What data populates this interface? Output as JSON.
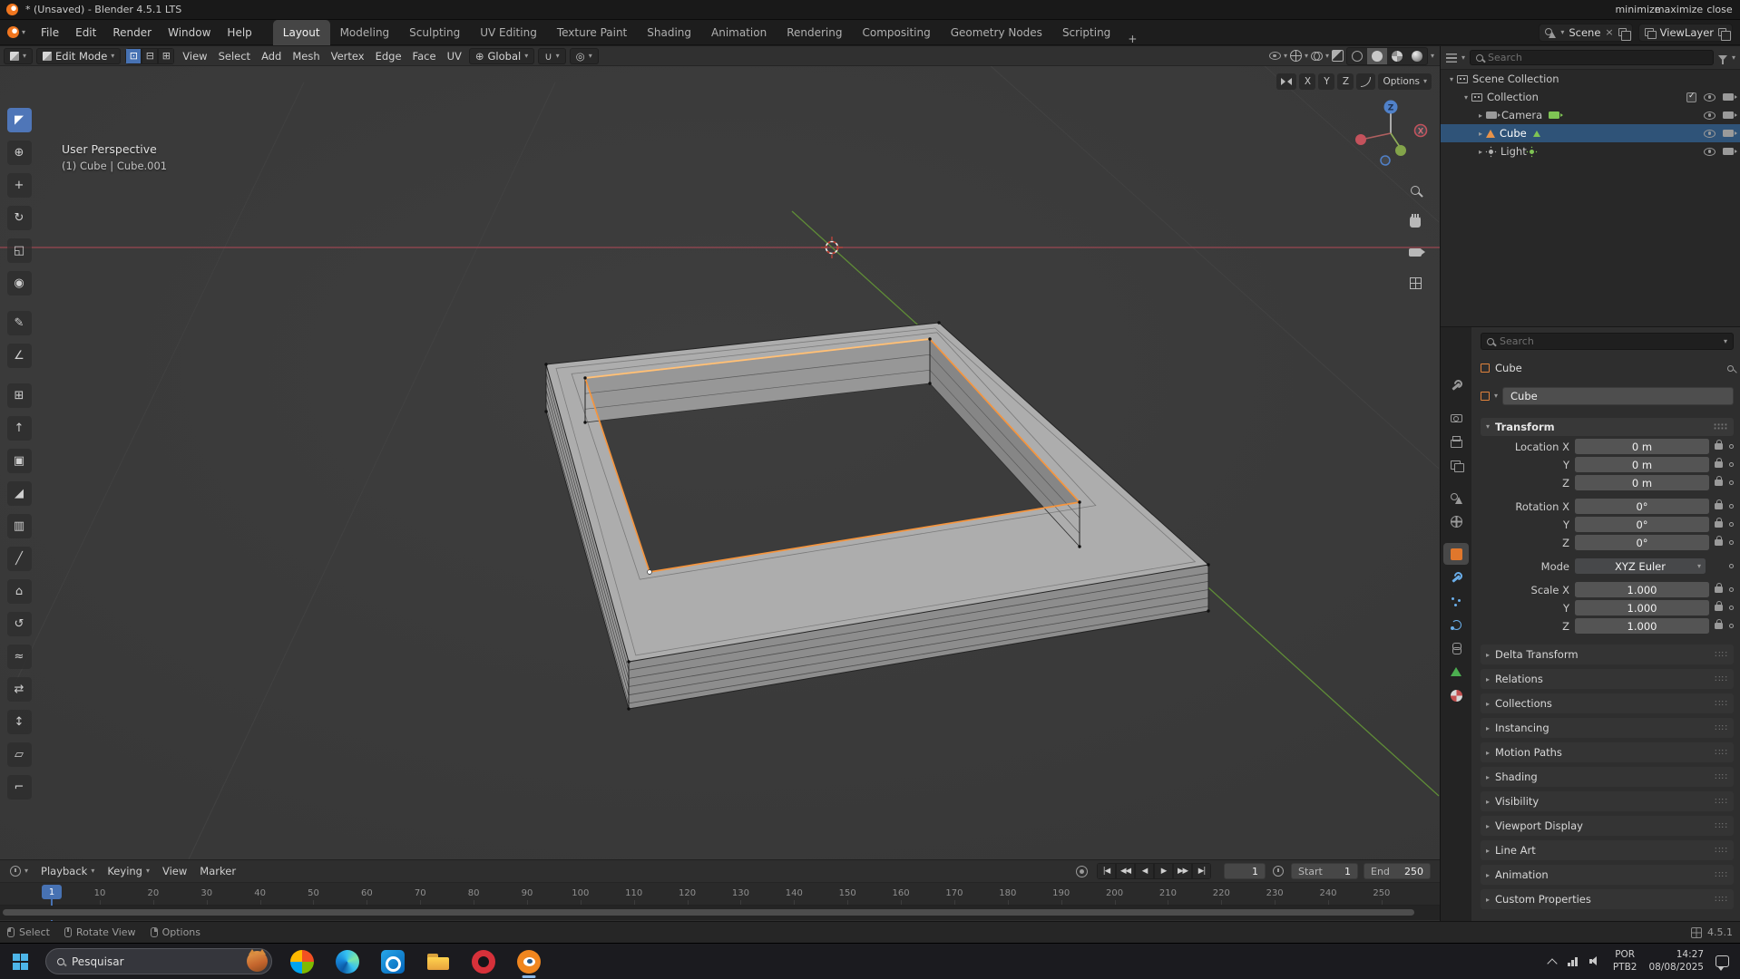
{
  "colors": {
    "accent_blue": "#4772b3",
    "selection_orange": "#f5953e",
    "object_orange": "#e0772c"
  },
  "window": {
    "title": "* (Unsaved) - Blender 4.5.1 LTS",
    "controls": [
      "minimize",
      "maximize",
      "close"
    ]
  },
  "menubar": {
    "menus": [
      "File",
      "Edit",
      "Render",
      "Window",
      "Help"
    ],
    "workspaces": [
      "Layout",
      "Modeling",
      "Sculpting",
      "UV Editing",
      "Texture Paint",
      "Shading",
      "Animation",
      "Rendering",
      "Compositing",
      "Geometry Nodes",
      "Scripting"
    ],
    "active_workspace": "Layout",
    "add_workspace_label": "+",
    "scene": {
      "label": "Scene"
    },
    "viewlayer": {
      "label": "ViewLayer"
    }
  },
  "viewport": {
    "header": {
      "mode": "Edit Mode",
      "select_modes": [
        "vertex-select",
        "edge-select",
        "face-select"
      ],
      "active_select_mode": "vertex-select",
      "menus": [
        "View",
        "Select",
        "Add",
        "Mesh",
        "Vertex",
        "Edge",
        "Face",
        "UV"
      ],
      "orientation": "Global",
      "shading_modes": [
        "wireframe",
        "solid",
        "material-preview",
        "rendered"
      ],
      "active_shading": "solid"
    },
    "tool_settings": {
      "mirror_x": "X",
      "mirror_y": "Y",
      "mirror_z": "Z",
      "options_label": "Options"
    },
    "overlay": {
      "view_name": "User Perspective",
      "object_info": "(1) Cube | Cube.001"
    },
    "nav_gizmo": {
      "x_label": "X",
      "z_label": "Z"
    },
    "side_icons": [
      "zoom-icon",
      "move-view-icon",
      "camera-view-icon",
      "toggle-projection-icon"
    ]
  },
  "toolbar": {
    "active_tool": "tweak",
    "tools": [
      "tweak",
      "cursor",
      "move",
      "rotate",
      "scale",
      "transform",
      "annotate",
      "measure",
      "add-cube",
      "extrude-region",
      "inset-faces",
      "bevel",
      "loop-cut",
      "knife",
      "poly-build",
      "spin",
      "smooth",
      "edge-slide",
      "shrink-fatten",
      "shear",
      "rip-region"
    ]
  },
  "outliner": {
    "search_placeholder": "Search",
    "rows": [
      {
        "label": "Scene Collection",
        "icon": "scene-collection",
        "arrow": "down",
        "indent": 0
      },
      {
        "label": "Collection",
        "icon": "collection",
        "arrow": "down",
        "indent": 1,
        "checkbox": true,
        "eye": true,
        "camera": true
      },
      {
        "label": "Camera",
        "icon": "camera",
        "data_icon": "camera-data",
        "arrow": "right",
        "indent": 2,
        "eye": true,
        "camera": true
      },
      {
        "label": "Cube",
        "icon": "mesh",
        "data_icon": "mesh-data",
        "arrow": "right",
        "indent": 2,
        "selected": true,
        "eye": true,
        "camera": true
      },
      {
        "label": "Light",
        "icon": "light",
        "data_icon": "light-data",
        "arrow": "right",
        "indent": 2,
        "eye": true,
        "camera": true
      }
    ]
  },
  "properties": {
    "search_placeholder": "Search",
    "breadcrumb": "Cube",
    "object_name": "Cube",
    "tabs": [
      "tool",
      "render",
      "output",
      "view-layer",
      "scene",
      "world",
      "object",
      "modifiers",
      "particles",
      "physics",
      "constraints",
      "object-data",
      "material"
    ],
    "active_tab": "object",
    "transform": {
      "title": "Transform",
      "rows": [
        {
          "label": "Location X",
          "value": "0 m",
          "type": "number",
          "group_start": false
        },
        {
          "label": "Y",
          "value": "0 m",
          "type": "number"
        },
        {
          "label": "Z",
          "value": "0 m",
          "type": "number"
        },
        {
          "label": "Rotation X",
          "value": "0°",
          "type": "number",
          "group_start": true
        },
        {
          "label": "Y",
          "value": "0°",
          "type": "number"
        },
        {
          "label": "Z",
          "value": "0°",
          "type": "number"
        },
        {
          "label": "Mode",
          "value": "XYZ Euler",
          "type": "dropdown",
          "group_start": true
        },
        {
          "label": "Scale X",
          "value": "1.000",
          "type": "number",
          "group_start": true
        },
        {
          "label": "Y",
          "value": "1.000",
          "type": "number"
        },
        {
          "label": "Z",
          "value": "1.000",
          "type": "number"
        }
      ]
    },
    "sections": [
      "Delta Transform",
      "Relations",
      "Collections",
      "Instancing",
      "Motion Paths",
      "Shading",
      "Visibility",
      "Viewport Display",
      "Line Art",
      "Animation",
      "Custom Properties"
    ]
  },
  "timeline": {
    "menus": [
      {
        "label": "Playback",
        "caret": true
      },
      {
        "label": "Keying",
        "caret": true
      },
      {
        "label": "View",
        "caret": false
      },
      {
        "label": "Marker",
        "caret": false
      }
    ],
    "transport": [
      "jump-to-start",
      "previous-keyframe",
      "play-reverse",
      "play",
      "next-keyframe",
      "jump-to-end"
    ],
    "current_frame": "1",
    "start_label": "Start",
    "start_value": "1",
    "end_label": "End",
    "end_value": "250",
    "ticks": [
      "10",
      "20",
      "30",
      "40",
      "50",
      "60",
      "70",
      "80",
      "90",
      "100",
      "110",
      "120",
      "130",
      "140",
      "150",
      "160",
      "170",
      "180",
      "190",
      "200",
      "210",
      "220",
      "230",
      "240",
      "250"
    ]
  },
  "statusbar": {
    "hints": [
      {
        "button": "left",
        "label": "Select"
      },
      {
        "button": "middle",
        "label": "Rotate View"
      },
      {
        "button": "right",
        "label": "Options"
      }
    ],
    "version": "4.5.1"
  },
  "taskbar": {
    "search_placeholder": "Pesquisar",
    "apps": [
      "copilot",
      "edge",
      "outlook",
      "explorer",
      "opera",
      "blender"
    ],
    "active_app": "blender",
    "tray": {
      "language_top": "POR",
      "language_bottom": "PTB2",
      "time": "14:27",
      "date": "08/08/2025"
    }
  }
}
